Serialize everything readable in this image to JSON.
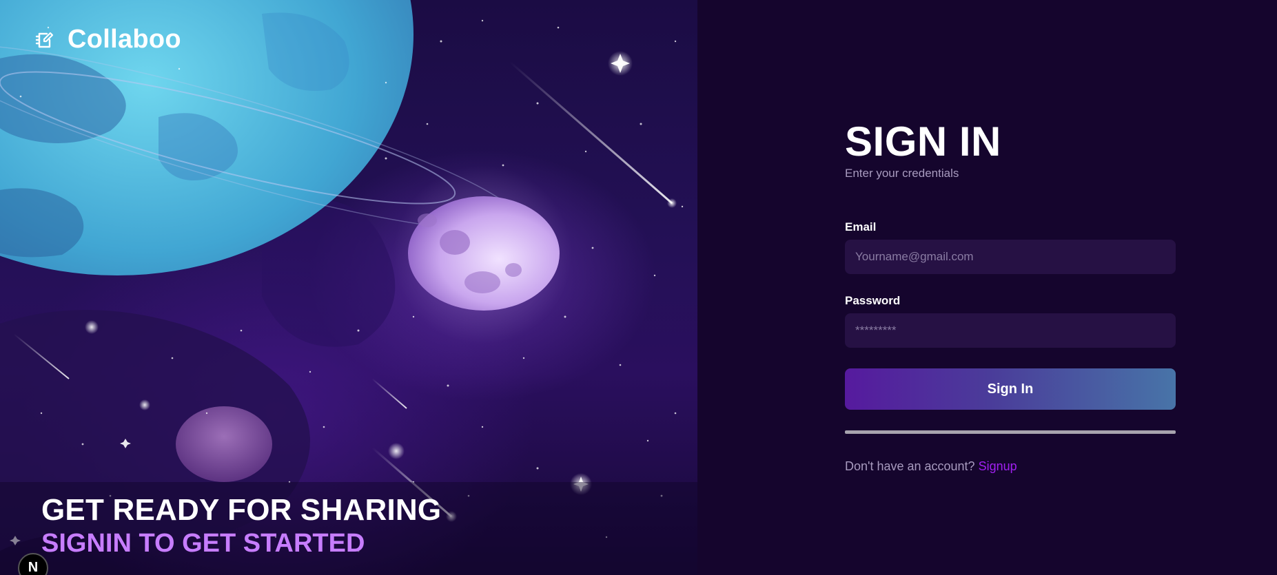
{
  "brand": {
    "name": "Collaboo",
    "icon": "notebook-edit-icon"
  },
  "hero": {
    "title": "GET READY FOR SHARING",
    "subtitle": "SIGNIN TO GET STARTED"
  },
  "badge": {
    "label": "N"
  },
  "auth": {
    "title": "SIGN IN",
    "subtitle": "Enter your credentials",
    "email_label": "Email",
    "email_placeholder": "Yourname@gmail.com",
    "email_value": "",
    "password_label": "Password",
    "password_placeholder": "*********",
    "password_value": "",
    "submit_label": "Sign In",
    "no_account_text": "Don't have an account?",
    "signup_link": "Signup"
  },
  "colors": {
    "page_background": "#15052d",
    "input_background": "#261144",
    "accent_purple": "#c77dff",
    "link_purple": "#a020f0",
    "button_gradient_start": "#561a9e",
    "button_gradient_end": "#4874a8"
  }
}
